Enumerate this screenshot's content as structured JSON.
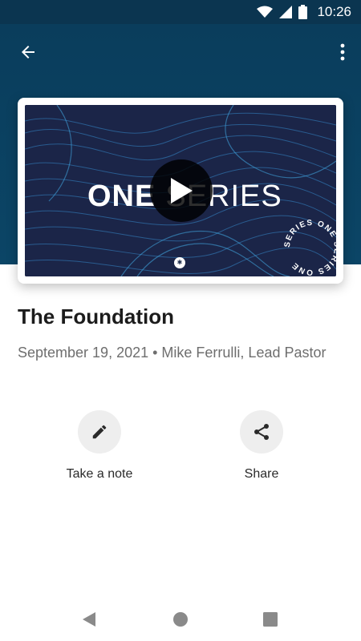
{
  "status_bar": {
    "time": "10:26",
    "icons": [
      "wifi-icon",
      "signal-icon",
      "battery-icon"
    ]
  },
  "toolbar": {
    "back_icon": "arrow-left-icon",
    "menu_icon": "more-vert-icon"
  },
  "video": {
    "series_word_1": "ONE",
    "series_word_2": "SERIES",
    "badge_text": "SERIES ONE SERIES ONE",
    "logo_glyph": "✱"
  },
  "sermon": {
    "title": "The Foundation",
    "meta": "September 19, 2021 • Mike Ferrulli, Lead Pastor"
  },
  "actions": [
    {
      "label": "Take a note",
      "icon": "pencil-icon"
    },
    {
      "label": "Share",
      "icon": "share-icon"
    }
  ],
  "colors": {
    "header": "#0b3d5c",
    "action_bg": "#eeeeee",
    "meta_text": "#6e6e6e"
  }
}
